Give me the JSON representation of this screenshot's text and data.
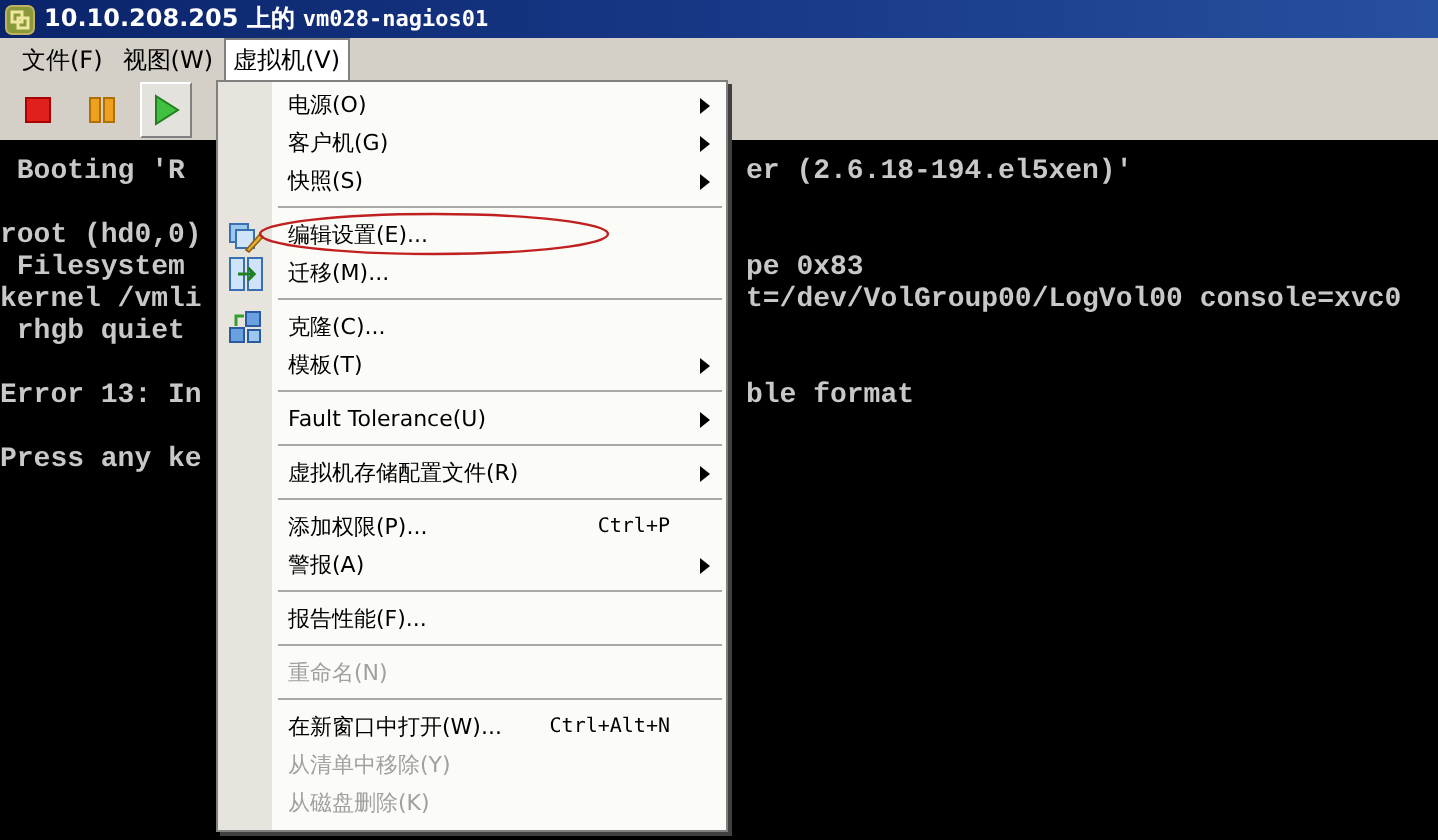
{
  "window": {
    "title_host": "10.10.208.205 上的",
    "title_vm": "vm028-nagios01"
  },
  "menubar": [
    {
      "label": "文件(F)",
      "selected": false
    },
    {
      "label": "视图(W)",
      "selected": false
    },
    {
      "label": "虚拟机(V)",
      "selected": true
    }
  ],
  "toolbar": [
    {
      "kind": "stop",
      "pressed": false
    },
    {
      "kind": "pause",
      "pressed": false
    },
    {
      "kind": "play",
      "pressed": true
    }
  ],
  "console": [
    [
      {
        "left": " Booting 'R",
        "right": "er (2.6.18-194.el5xen)'"
      }
    ],
    [
      {
        "left": "root (hd0,0)"
      },
      {
        "left": " Filesystem",
        "right": "pe 0x83"
      },
      {
        "left": "kernel /vmli",
        "right": "t=/dev/VolGroup00/LogVol00 console=xvc0"
      },
      {
        "left": " rhgb quiet"
      }
    ],
    [
      {
        "left": "Error 13: In",
        "right": "ble format"
      }
    ],
    [
      {
        "left": "Press any ke"
      }
    ]
  ],
  "menu": [
    {
      "kind": "item",
      "label": "电源(O)",
      "submenu": true,
      "disabled": false
    },
    {
      "kind": "item",
      "label": "客户机(G)",
      "submenu": true,
      "disabled": false
    },
    {
      "kind": "item",
      "label": "快照(S)",
      "submenu": true,
      "disabled": false
    },
    {
      "kind": "separator"
    },
    {
      "kind": "item",
      "label": "编辑设置(E)...",
      "icon": true,
      "circled": true,
      "disabled": false
    },
    {
      "kind": "item",
      "label": "迁移(M)...",
      "icon": true,
      "disabled": false
    },
    {
      "kind": "separator"
    },
    {
      "kind": "item",
      "label": "克隆(C)...",
      "icon": true,
      "disabled": false
    },
    {
      "kind": "item",
      "label": "模板(T)",
      "submenu": true,
      "disabled": false
    },
    {
      "kind": "separator"
    },
    {
      "kind": "item",
      "label": "Fault Tolerance(U)",
      "submenu": true,
      "disabled": false
    },
    {
      "kind": "separator"
    },
    {
      "kind": "item",
      "label": "虚拟机存储配置文件(R)",
      "submenu": true,
      "disabled": false
    },
    {
      "kind": "separator"
    },
    {
      "kind": "item",
      "label": "添加权限(P)...",
      "shortcut": "Ctrl+P",
      "disabled": false
    },
    {
      "kind": "item",
      "label": "警报(A)",
      "submenu": true,
      "disabled": false
    },
    {
      "kind": "separator"
    },
    {
      "kind": "item",
      "label": "报告性能(F)...",
      "disabled": false
    },
    {
      "kind": "separator"
    },
    {
      "kind": "item",
      "label": "重命名(N)",
      "disabled": true
    },
    {
      "kind": "separator"
    },
    {
      "kind": "item",
      "label": "在新窗口中打开(W)...",
      "shortcut": "Ctrl+Alt+N",
      "disabled": false
    },
    {
      "kind": "item",
      "label": "从清单中移除(Y)",
      "disabled": true
    },
    {
      "kind": "item",
      "label": "从磁盘删除(K)",
      "disabled": true
    }
  ]
}
